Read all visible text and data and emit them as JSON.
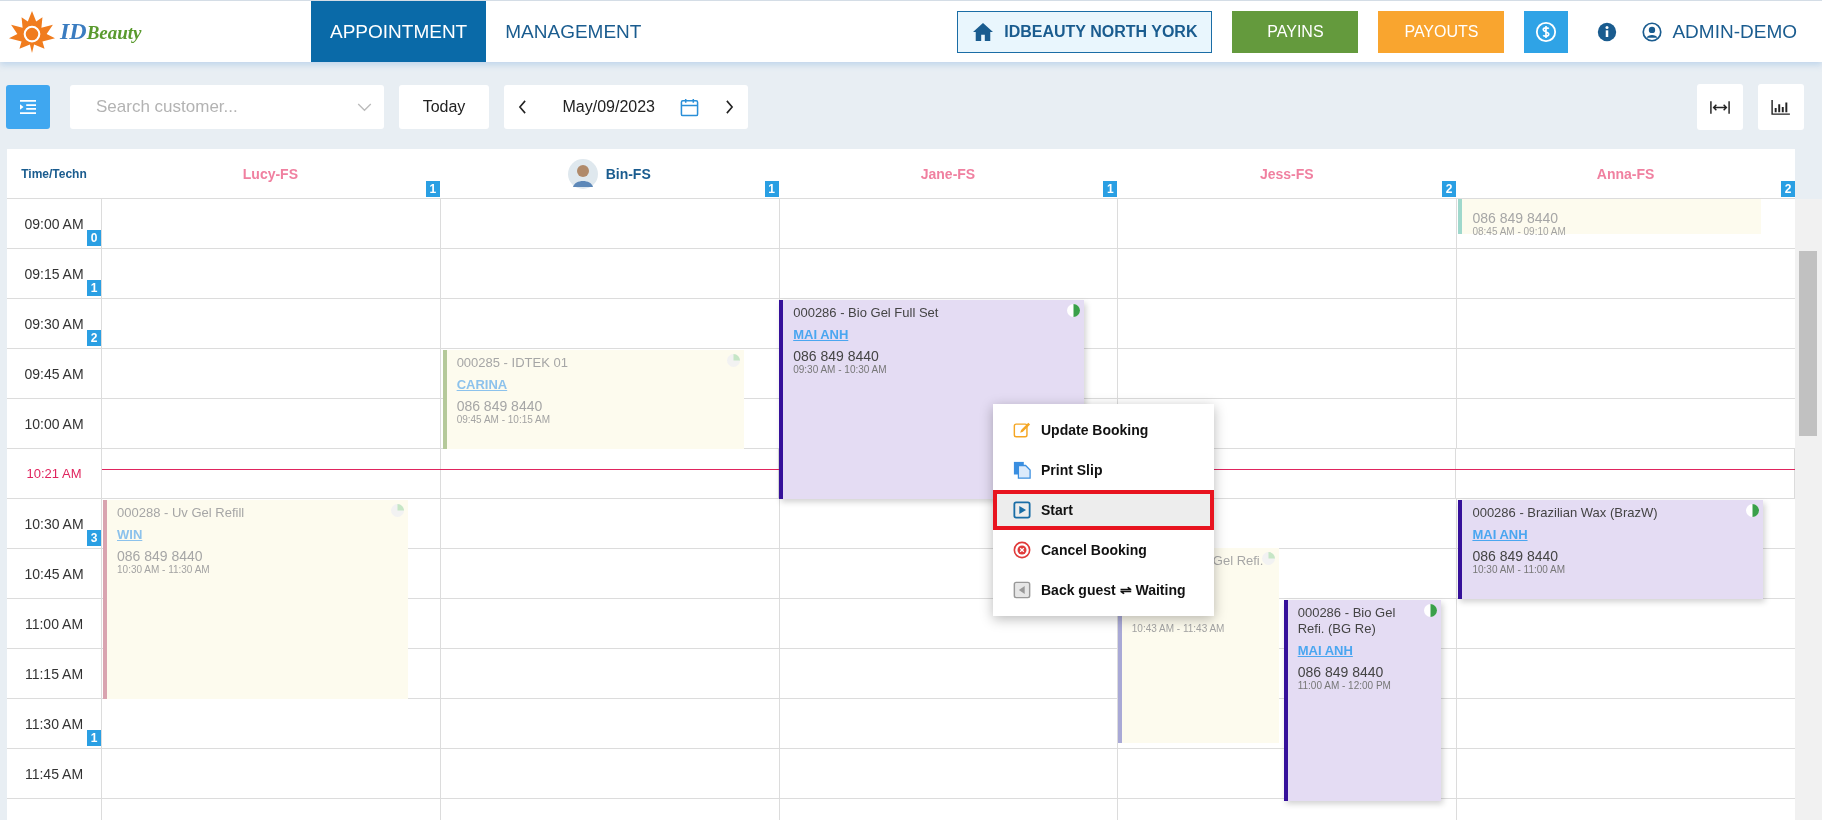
{
  "header": {
    "logo": {
      "prefix": "ID",
      "name": "Beauty"
    },
    "tabs": [
      {
        "label": "APPOINTMENT",
        "selected": true
      },
      {
        "label": "MANAGEMENT",
        "selected": false
      }
    ],
    "branch": "IDBEAUTY NORTH YORK",
    "actions": [
      {
        "label": "PAYINS",
        "kind": "payins"
      },
      {
        "label": "PAYOUTS",
        "kind": "payouts"
      }
    ],
    "user": "ADMIN-DEMO"
  },
  "toolbar": {
    "search": {
      "placeholder": "Search customer..."
    },
    "today": "Today",
    "date": "May/09/2023"
  },
  "calendar": {
    "corner": "Time/Techn",
    "technicians": [
      {
        "name": "Lucy-FS",
        "count": "1",
        "avatar": false,
        "color": "#f080a0"
      },
      {
        "name": "Bin-FS",
        "count": "1",
        "avatar": true,
        "color": "#1a5c8f"
      },
      {
        "name": "Jane-FS",
        "count": "1",
        "avatar": false,
        "color": "#f080a0"
      },
      {
        "name": "Jess-FS",
        "count": "2",
        "avatar": false,
        "color": "#f080a0"
      },
      {
        "name": "Anna-FS",
        "count": "2",
        "avatar": false,
        "color": "#f080a0"
      }
    ],
    "rows": [
      {
        "time": "09:00 AM",
        "count": "0",
        "kind": "slot"
      },
      {
        "time": "09:15 AM",
        "count": "1",
        "kind": "slot"
      },
      {
        "time": "09:30 AM",
        "count": "2",
        "kind": "slot"
      },
      {
        "time": "09:45 AM",
        "kind": "slot"
      },
      {
        "time": "10:00 AM",
        "kind": "slot"
      },
      {
        "time": "10:21 AM",
        "kind": "now"
      },
      {
        "time": "10:30 AM",
        "count": "3",
        "kind": "slot"
      },
      {
        "time": "10:45 AM",
        "kind": "slot"
      },
      {
        "time": "11:00 AM",
        "kind": "slot"
      },
      {
        "time": "11:15 AM",
        "kind": "slot"
      },
      {
        "time": "11:30 AM",
        "count": "1",
        "kind": "slot"
      },
      {
        "time": "11:45 AM",
        "kind": "slot"
      }
    ],
    "events": [
      {
        "phone": "086 849 8440",
        "time": "08:45 AM - 09:10 AM",
        "faded": true,
        "color": "#9fd8cc"
      },
      {
        "title": "000285 - IDTEK 01",
        "customer": "CARINA",
        "phone": "086 849 8440",
        "time": "09:45 AM - 10:15 AM",
        "faded": true,
        "color": "#b5c99a"
      },
      {
        "title": "000286 - Bio Gel Full Set",
        "customer": "MAI ANH",
        "phone": "086 849 8440",
        "time": "09:30 AM - 10:30 AM",
        "faded": false,
        "color": "#35109a"
      },
      {
        "title": "000288 - Uv Gel Refill",
        "customer": "WIN",
        "phone": "086 849 8440",
        "time": "10:30 AM - 11:30 AM",
        "faded": true,
        "color": "#d9a4b0"
      },
      {
        "title": "Gel Refi.",
        "time": "10:43 AM - 11:43 AM",
        "faded": true,
        "color": "#a9a9d6"
      },
      {
        "title": "000286 - Bio Gel Refi. (BG Re)",
        "customer": "MAI ANH",
        "phone": "086 849 8440",
        "time": "11:00 AM - 12:00 PM",
        "faded": false,
        "color": "#35109a"
      },
      {
        "title": "000286 - Brazilian Wax (BrazW)",
        "customer": "MAI ANH",
        "phone": "086 849 8440",
        "time": "10:30 AM - 11:00 AM",
        "faded": false,
        "color": "#35109a"
      }
    ],
    "context_menu": {
      "items": [
        {
          "label": "Update Booking",
          "kind": "update",
          "selected": false
        },
        {
          "label": "Print Slip",
          "kind": "print",
          "selected": false
        },
        {
          "label": "Start",
          "kind": "start",
          "selected": true
        },
        {
          "label": "Cancel Booking",
          "kind": "cancel",
          "selected": false
        },
        {
          "label": "Back guest ⇌ Waiting",
          "kind": "back",
          "selected": false
        }
      ]
    }
  }
}
